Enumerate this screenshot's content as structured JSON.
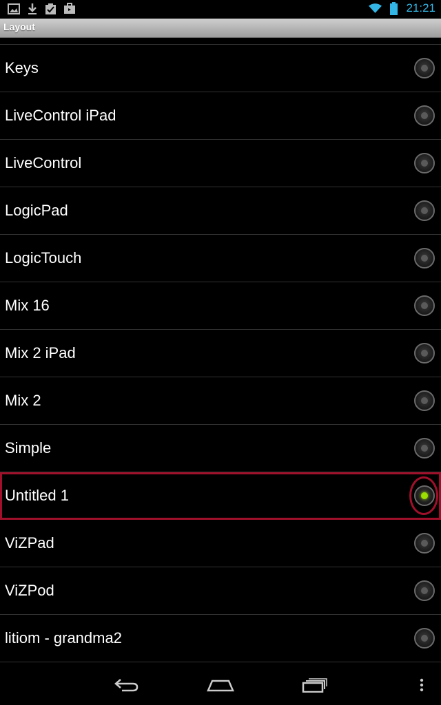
{
  "statusbar": {
    "icons": [
      "image-icon",
      "download-icon",
      "clipboard-check-icon",
      "briefcase-icon"
    ],
    "right_icons": [
      "wifi-icon",
      "battery-icon"
    ],
    "clock": "21:21",
    "accent": "#33b5e5"
  },
  "titlebar": {
    "title": "Layout"
  },
  "list": {
    "items": [
      {
        "label": "Keys",
        "selected": false
      },
      {
        "label": "LiveControl iPad",
        "selected": false
      },
      {
        "label": "LiveControl",
        "selected": false
      },
      {
        "label": "LogicPad",
        "selected": false
      },
      {
        "label": "LogicTouch",
        "selected": false
      },
      {
        "label": "Mix 16",
        "selected": false
      },
      {
        "label": "Mix 2 iPad",
        "selected": false
      },
      {
        "label": "Mix 2",
        "selected": false
      },
      {
        "label": "Simple",
        "selected": false
      },
      {
        "label": "Untitled 1",
        "selected": true
      },
      {
        "label": "ViZPad",
        "selected": false
      },
      {
        "label": "ViZPod",
        "selected": false
      },
      {
        "label": "litiom - grandma2",
        "selected": false
      }
    ],
    "selected_color": "#9be000",
    "highlight_color": "#a0102a"
  },
  "navbar": {
    "buttons": [
      "back-icon",
      "home-icon",
      "recents-icon",
      "menu-icon"
    ]
  }
}
